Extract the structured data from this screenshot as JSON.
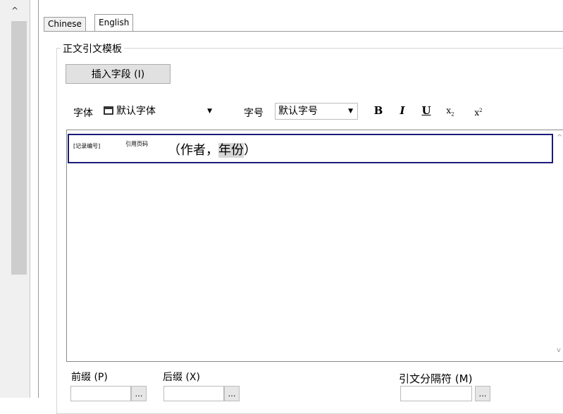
{
  "tabs": [
    {
      "label": "Chinese"
    },
    {
      "label": "English"
    }
  ],
  "group": {
    "title": "正文引文模板"
  },
  "toolbar": {
    "insert_field_label": "插入字段 (I)",
    "font_label": "字体",
    "font_value": "默认字体",
    "size_label": "字号",
    "size_value": "默认字号",
    "bold_label": "B",
    "italic_label": "I",
    "underline_label": "U",
    "subscript_label": "x",
    "subscript_mark": "2",
    "superscript_label": "x",
    "superscript_mark": "2"
  },
  "editor": {
    "record_no": "[记录编号]",
    "cited_pages": "引用页码",
    "author_year_open": "（作者，",
    "year": "年份",
    "author_year_close": "）"
  },
  "bottom": {
    "prefix_label": "前缀 (P)",
    "suffix_label": "后缀 (X)",
    "separator_label": "引文分隔符 (M)",
    "prefix_button": "…",
    "suffix_button": "…",
    "separator_button": "…"
  }
}
